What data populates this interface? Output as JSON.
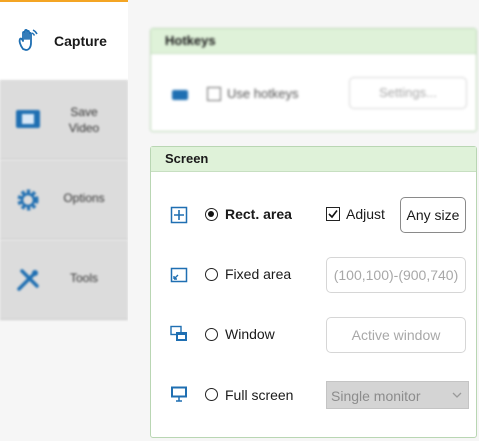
{
  "sidebar": {
    "tabs": [
      {
        "label": "Capture",
        "icon": "hand-icon",
        "active": true
      },
      {
        "label": "Save\nVideo",
        "icon": "film-icon",
        "active": false
      },
      {
        "label": "Options",
        "icon": "gear-icon",
        "active": false
      },
      {
        "label": "Tools",
        "icon": "tools-icon",
        "active": false
      }
    ]
  },
  "hotkeys": {
    "title": "Hotkeys",
    "use_hotkeys_label": "Use hotkeys",
    "settings_label": "Settings..."
  },
  "screen": {
    "title": "Screen",
    "rect_area": {
      "label": "Rect. area",
      "selected": true,
      "adjust_label": "Adjust",
      "adjust_checked": true,
      "size_button": "Any size"
    },
    "fixed_area": {
      "label": "Fixed area",
      "selected": false,
      "value": "(100,100)-(900,740)"
    },
    "window": {
      "label": "Window",
      "selected": false,
      "button": "Active window"
    },
    "full_screen": {
      "label": "Full screen",
      "selected": false,
      "select_value": "Single monitor"
    }
  },
  "colors": {
    "accent": "#f4a524",
    "icon_blue": "#1f6fb2",
    "header_green": "#dff2d9"
  }
}
